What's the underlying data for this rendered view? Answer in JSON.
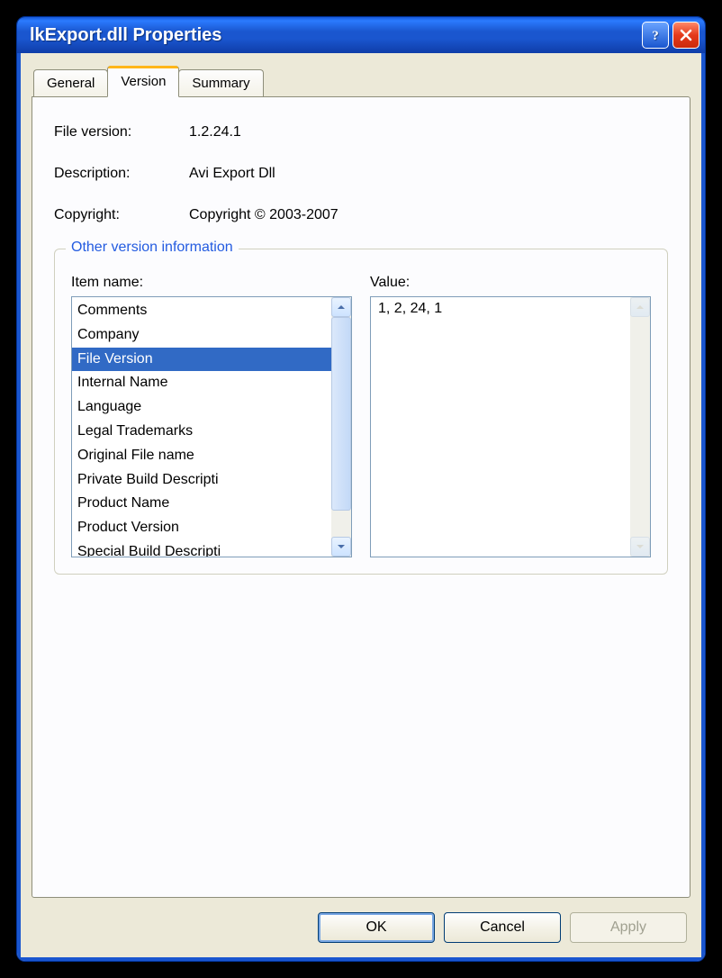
{
  "window": {
    "title": "lkExport.dll Properties"
  },
  "tabs": {
    "general": "General",
    "version": "Version",
    "summary": "Summary"
  },
  "fields": {
    "file_version_label": "File version:",
    "file_version_value": "1.2.24.1",
    "description_label": "Description:",
    "description_value": "Avi Export Dll",
    "copyright_label": "Copyright:",
    "copyright_value": "Copyright © 2003-2007"
  },
  "groupbox": {
    "legend": "Other version information",
    "item_name_label": "Item name:",
    "value_label": "Value:"
  },
  "items": {
    "i0": "Comments",
    "i1": "Company",
    "i2": "File Version",
    "i3": "Internal Name",
    "i4": "Language",
    "i5": "Legal Trademarks",
    "i6": "Original File name",
    "i7": "Private Build Descripti",
    "i8": "Product Name",
    "i9": "Product Version",
    "i10": "Special Build Descripti"
  },
  "value_text": "1, 2, 24, 1",
  "buttons": {
    "ok": "OK",
    "cancel": "Cancel",
    "apply": "Apply"
  }
}
